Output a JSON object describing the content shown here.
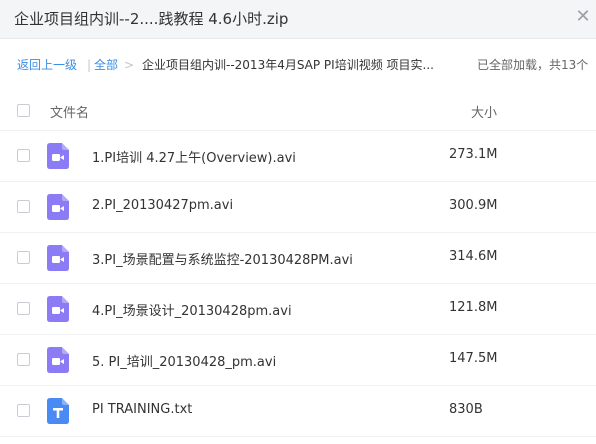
{
  "window": {
    "title": "企业项目组内训--2....践教程 4.6小时.zip",
    "close_glyph": "✕"
  },
  "breadcrumb": {
    "back_label": "返回上一级",
    "separator": "|",
    "all_label": "全部",
    "arrow": ">",
    "path": "企业项目组内训--2013年4月SAP PI培训视频 项目实...",
    "status": "已全部加载，共13个"
  },
  "columns": {
    "name": "文件名",
    "size": "大小"
  },
  "colors": {
    "accent": "#3a8ee6",
    "video_icon": "#8b7cf6",
    "text_icon": "#4a8af4"
  },
  "files": [
    {
      "name": "1.PI培训 4.27上午(Overview).avi",
      "size": "273.1M",
      "icon": "video-file-icon"
    },
    {
      "name": "2.PI_20130427pm.avi",
      "size": "300.9M",
      "icon": "video-file-icon"
    },
    {
      "name": "3.PI_场景配置与系统监控-20130428PM.avi",
      "size": "314.6M",
      "icon": "video-file-icon"
    },
    {
      "name": "4.PI_场景设计_20130428pm.avi",
      "size": "121.8M",
      "icon": "video-file-icon"
    },
    {
      "name": "5. PI_培训_20130428_pm.avi",
      "size": "147.5M",
      "icon": "video-file-icon"
    },
    {
      "name": "PI TRAINING.txt",
      "size": "830B",
      "icon": "text-file-icon"
    }
  ]
}
